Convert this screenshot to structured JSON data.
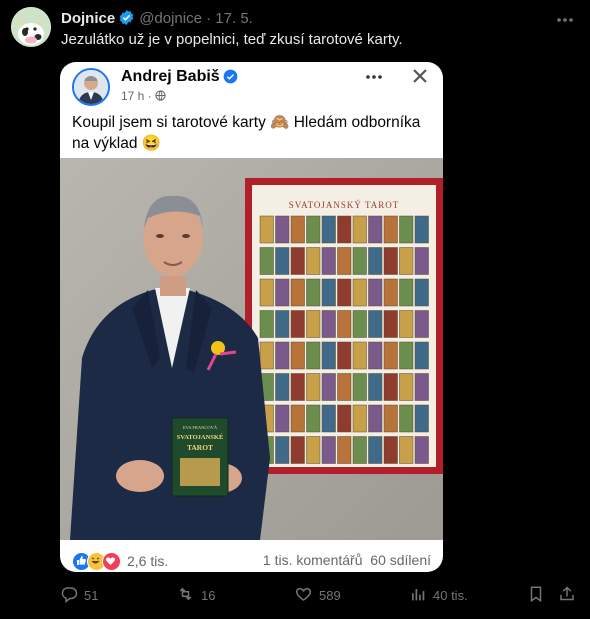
{
  "tweet": {
    "author_name": "Dojnice",
    "handle": "@dojnice",
    "separator": "·",
    "date": "17. 5.",
    "text": "Jezulátko už je v popelnici, teď zkusí tarotové karty."
  },
  "embedded_post": {
    "author_name": "Andrej Babiš",
    "time": "17 h ·",
    "text": "Koupil jsem si tarotové karty 🙈 Hledám odborníka na výklad 😆",
    "poster_title": "SVATOJANSKÝ TAROT",
    "book_author": "EVA FRANCOVÁ",
    "book_title_line1": "SVATOJANSKÉ",
    "book_title_line2": "TAROT",
    "reactions_count": "2,6 tis.",
    "comments": "1 tis. komentářů",
    "shares": "60 sdílení"
  },
  "actions": {
    "replies": "51",
    "reposts": "16",
    "likes": "589",
    "views": "40 tis."
  },
  "colors": {
    "background": "#000000",
    "text": "#e7e9ea",
    "muted": "#71767b",
    "verified": "#1d9bf0",
    "fb_blue": "#1877f2",
    "poster_frame": "#b0202a"
  }
}
